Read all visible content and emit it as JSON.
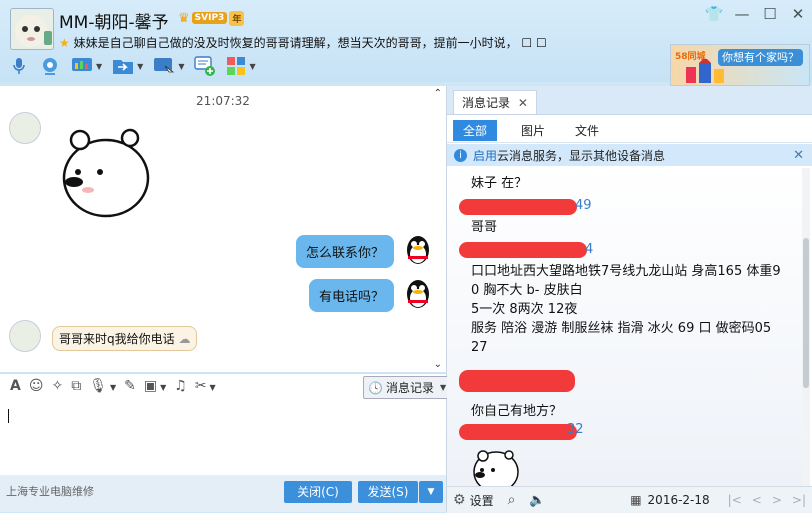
{
  "header": {
    "contact_name": "MM-朝阳-馨予",
    "vip_label": "SVIP3",
    "vip_year": "年",
    "signature": "妹妹是自己聊自己做的没及时恢复的哥哥请理解，想当天次的哥哥，提前一小时说， ",
    "ad_text": "你想有个家吗？",
    "ad_brand": "58同城"
  },
  "toolbar": {
    "icons": [
      "microphone-icon",
      "video-call-icon",
      "screen-share-icon",
      "file-transfer-icon",
      "remote-desktop-icon",
      "add-chat-icon",
      "apps-grid-icon"
    ]
  },
  "chat": {
    "time": "21:07:32",
    "messages": [
      {
        "side": "left",
        "type": "sticker"
      },
      {
        "side": "right",
        "text": "怎么联系你？"
      },
      {
        "side": "right",
        "text": "有电话吗？"
      },
      {
        "side": "left",
        "text": "哥哥来时q我给你电话"
      }
    ]
  },
  "input": {
    "history_button": "消息记录",
    "footer_text": "上海专业电脑维修",
    "close_button": "关闭(C)",
    "send_button": "发送(S)"
  },
  "history": {
    "tab_label": "消息记录",
    "filters": [
      "全部",
      "图片",
      "文件"
    ],
    "active_filter": "全部",
    "notice_link": "启用",
    "notice_text": "云消息服务，显示其他设备消息",
    "lines": [
      "妹子 在？",
      "49",
      "哥哥",
      "4",
      "口口地址西大望路地铁7号线九龙山站 身高165 体重9",
      "0 胸不大 b- 皮肤白",
      "5一次 8两次 12夜",
      "服务 陪浴 漫游 制服丝袜 指滑 冰火 69 口 做密码05",
      "27",
      "你自己有地方？",
      "32"
    ],
    "settings_label": "设置",
    "date": "2016-2-18"
  }
}
